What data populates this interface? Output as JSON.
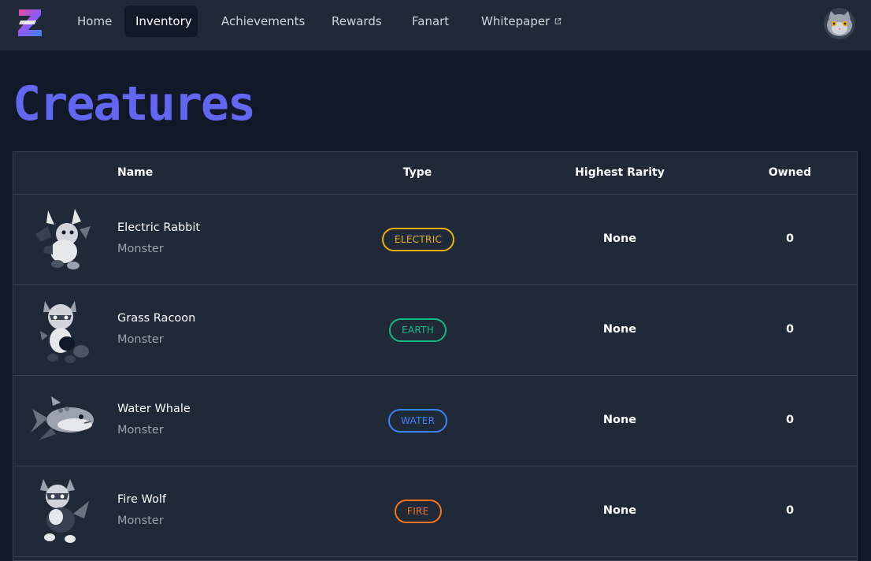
{
  "nav": {
    "items": [
      {
        "label": "Home"
      },
      {
        "label": "Inventory"
      },
      {
        "label": "Achievements"
      },
      {
        "label": "Rewards"
      },
      {
        "label": "Fanart"
      },
      {
        "label": "Whitepaper"
      }
    ],
    "active": "Inventory",
    "external_icon": "external-link-icon",
    "avatar_icon": "cat-avatar-icon"
  },
  "page": {
    "title": "Creatures"
  },
  "table": {
    "headers": {
      "image": "",
      "name": "Name",
      "type": "Type",
      "rarity": "Highest Rarity",
      "owned": "Owned"
    },
    "rows": [
      {
        "name": "Electric Rabbit",
        "kind": "Monster",
        "type": "ELECTRIC",
        "type_color": "#eab308",
        "rarity": "None",
        "owned": "0",
        "icon": "rabbit-creature-icon"
      },
      {
        "name": "Grass Racoon",
        "kind": "Monster",
        "type": "EARTH",
        "type_color": "#10b981",
        "rarity": "None",
        "owned": "0",
        "icon": "racoon-creature-icon"
      },
      {
        "name": "Water Whale",
        "kind": "Monster",
        "type": "WATER",
        "type_color": "#3b82f6",
        "rarity": "None",
        "owned": "0",
        "icon": "whale-creature-icon"
      },
      {
        "name": "Fire Wolf",
        "kind": "Monster",
        "type": "FIRE",
        "type_color": "#f97316",
        "rarity": "None",
        "owned": "0",
        "icon": "wolf-creature-icon"
      }
    ]
  },
  "colors": {
    "background": "#111827",
    "surface": "#1f2937",
    "accent": "#6366f1",
    "border": "#374151"
  }
}
